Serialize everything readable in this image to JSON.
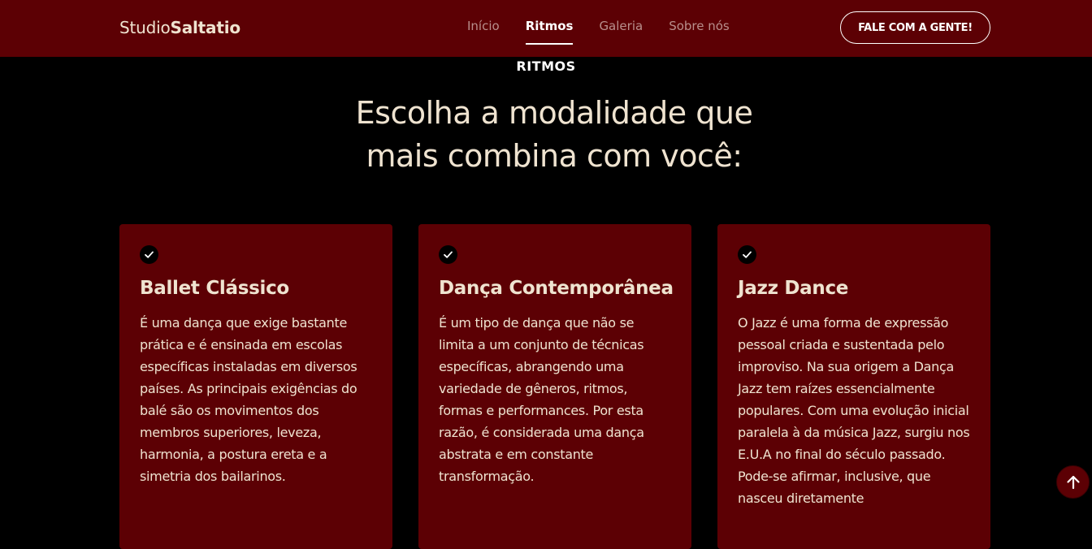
{
  "navbar": {
    "logo_light": "Studio",
    "logo_bold": "Saltatio",
    "links": [
      {
        "label": "Início"
      },
      {
        "label": "Ritmos"
      },
      {
        "label": "Galeria"
      },
      {
        "label": "Sobre nós"
      }
    ],
    "active_link": "Ritmos",
    "cta_label": "FALE COM A GENTE!"
  },
  "section": {
    "label": "RITMOS",
    "title": "Escolha a modalidade que mais combina com você:"
  },
  "cards": [
    {
      "icon": "check-icon",
      "title": "Ballet Clássico",
      "text": "É uma dança que exige bastante prática e é ensinada em escolas específicas instaladas em diversos países. As principais exigências do balé são os movimentos dos membros superiores, leveza, harmonia, a postura ereta e a simetria dos bailarinos."
    },
    {
      "icon": "check-icon",
      "title": "Dança Contemporânea",
      "text": "É um tipo de dança que não se limita a um conjunto de técnicas específicas, abrangendo uma variedade de gêneros, ritmos, formas e performances. Por esta razão, é considerada uma dança abstrata e em constante transformação."
    },
    {
      "icon": "check-icon",
      "title": "Jazz Dance",
      "text": "O Jazz é uma forma de expressão pessoal criada e sustentada pelo improviso. Na sua origem a Dança Jazz tem raízes essencialmente populares. Com uma evolução inicial paralela à da música Jazz, surgiu nos E.U.A no final do século passado. Pode-se afirmar, inclusive, que nasceu diretamente"
    }
  ],
  "back_to_top_icon": "arrow-up-icon",
  "colors": {
    "brand": "#5c0004",
    "background": "#000000",
    "text": "#efe3d0"
  }
}
